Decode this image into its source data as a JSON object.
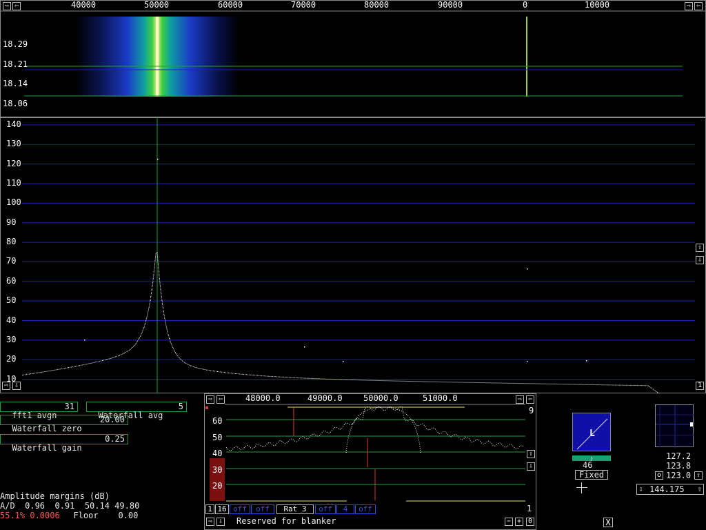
{
  "top_axis": {
    "ticks": [
      "40000",
      "50000",
      "60000",
      "70000",
      "80000",
      "90000",
      "0",
      "10000"
    ]
  },
  "waterfall": {
    "ylabels": [
      "18.29",
      "18.21",
      "18.14",
      "18.06"
    ]
  },
  "spectrum": {
    "ylabels": [
      "140",
      "130",
      "120",
      "110",
      "100",
      "90",
      "80",
      "70",
      "60",
      "50",
      "40",
      "30",
      "20",
      "10"
    ]
  },
  "controls": {
    "fft1_avgn_label": "fft1 avgn",
    "fft1_avgn_value": "31",
    "waterfall_avg_label": "Waterfall avg",
    "waterfall_avg_value": "5",
    "waterfall_zero_label": "Waterfall zero",
    "waterfall_zero_value": "20.00",
    "waterfall_gain_label": "Waterfall gain",
    "waterfall_gain_value": "0.25"
  },
  "status": {
    "amp_title": "Amplitude margins (dB)",
    "ad_line": "A/D  0.96  0.91  50.14 49.80",
    "pct_line": "55.1% 0.0006",
    "floor_line": "  Floor    0.00"
  },
  "baseband": {
    "ticks": [
      "48000.0",
      "49000.0",
      "50000.0",
      "51000.0"
    ],
    "ylabels": [
      "60",
      "50",
      "40",
      "30",
      "20"
    ],
    "right_top": "9",
    "right_bottom": "1",
    "bottom_buttons": [
      "1",
      "16",
      "off",
      "off",
      "Rat  3",
      "off",
      "  4",
      "off"
    ],
    "blanker_text": "Reserved for blanker"
  },
  "s_meter": {
    "label": "L",
    "value": "46",
    "mode": "Fixed"
  },
  "freq_panel": {
    "v1": "127.2",
    "v2": "123.8",
    "v3": "123.0",
    "o_label": "o",
    "freq": "144.175"
  },
  "close_label": "X",
  "colors": {
    "grid_blue": "#1e1ebe",
    "grid_green": "#1fa03a",
    "trace": "#ffffff",
    "marker_red": "#e03a30",
    "accent_yellow": "#e8e070"
  }
}
